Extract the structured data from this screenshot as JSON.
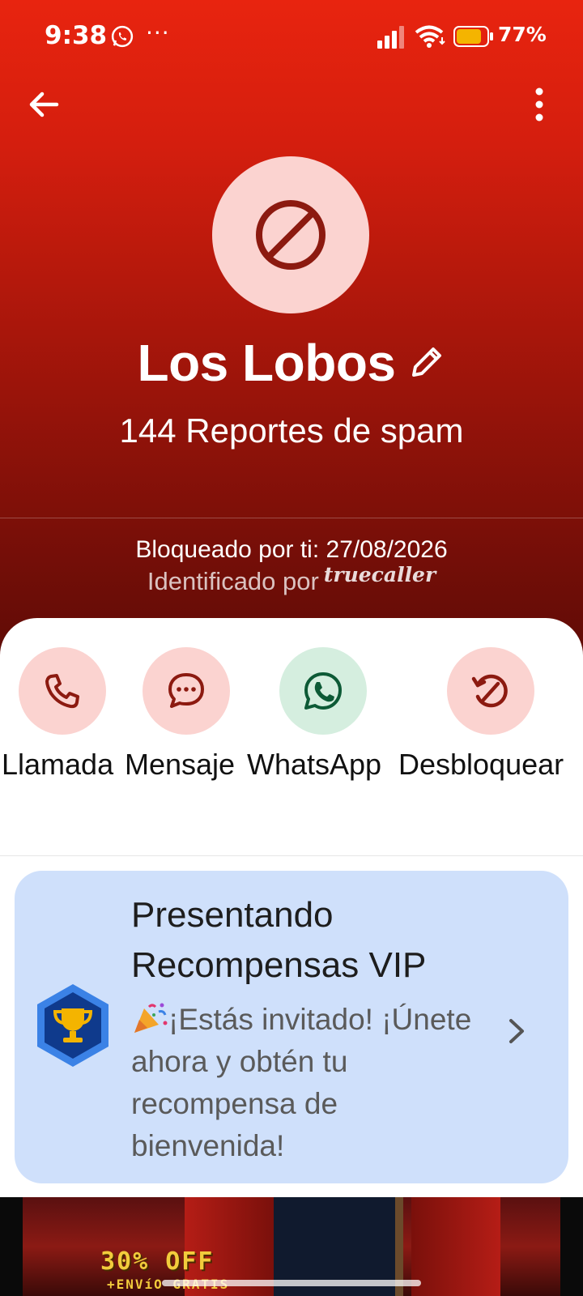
{
  "status_bar": {
    "time": "9:38",
    "dots": "···",
    "battery_pct": "77%",
    "icons": [
      "whatsapp-icon",
      "signal-icon",
      "wifi-icon",
      "battery-icon"
    ]
  },
  "toolbar": {
    "back_icon": "arrow-left-icon",
    "more_icon": "more-vertical-icon"
  },
  "contact": {
    "name": "Los Lobos",
    "spam_reports": "144 Reportes de spam",
    "blocked_by": "Bloqueado por ti: 27/08/2026",
    "identified_by": "Identificado por",
    "brand_logo": "truecaller"
  },
  "actions": [
    {
      "label": "Llamada",
      "icon": "phone-icon"
    },
    {
      "label": "Mensaje",
      "icon": "message-icon"
    },
    {
      "label": "WhatsApp",
      "icon": "whatsapp-icon"
    },
    {
      "label": "Desbloquear",
      "icon": "unblock-icon"
    }
  ],
  "vip_card": {
    "title": "Presentando Recompensas VIP",
    "description": "¡Estás invitado! ¡Únete ahora y obtén tu recompensa de bienvenida!",
    "badge_icon": "trophy-badge-icon",
    "emoji_icon": "party-popper-icon",
    "chevron_icon": "chevron-right-icon"
  },
  "ad": {
    "headline": "30% OFF",
    "subline": "+ENVíO GRATIS"
  },
  "colors": {
    "header_top": "#e8240f",
    "header_bottom": "#5e0b06",
    "action_red_bg": "#fbd3d0",
    "action_green_bg": "#d5eedf",
    "action_red_icon": "#8c1a10",
    "whatsapp_icon": "#0d5a36",
    "vip_card_bg": "#cfe0fb"
  }
}
